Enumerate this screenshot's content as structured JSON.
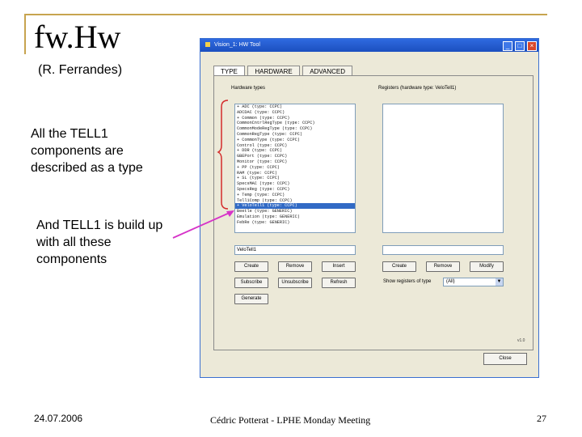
{
  "slide": {
    "title": "fw.Hw",
    "author": "(R. Ferrandes)",
    "text1": "All the TELL1 components are described as a type",
    "text2": "And TELL1 is build up with all these components",
    "footer_date": "24.07.2006",
    "footer_center": "Cédric Potterat - LPHE Monday Meeting",
    "page_number": "27"
  },
  "colors": {
    "frame_accent": "#c7a44f",
    "brace_red": "#d42a2a",
    "arrow_magenta": "#d633c8",
    "selection_blue": "#316ac5"
  },
  "window": {
    "title": "Vision_1: HW Tool",
    "tabs": [
      "TYPE",
      "HARDWARE",
      "ADVANCED"
    ],
    "active_tab": "TYPE",
    "hardware_types_label": "Hardware types",
    "registers_label": "Registers (hardware type: VeloTell1)",
    "hardware_types": [
      "+ ADC (type: CCPC)",
      "ADCDAC (type: CCPC)",
      "+ Common (type: CCPC)",
      "CommonCntrlRegType (type: CCPC)",
      "CommonModeRegType (type: CCPC)",
      "CommonRegType (type: CCPC)",
      "+ CommonType (type: CCPC)",
      "Control (type: CCPC)",
      "+ DDR (type: CCPC)",
      "GBEPort (type: CCPC)",
      "Monitor (type: CCPC)",
      "+ PP (type: CCPC)",
      "RAM (type: CCPC)",
      "+ SL (type: CCPC)",
      "SpecsMAC (type: CCPC)",
      "SpecsReg (type: CCPC)",
      "+ Temp (type: CCPC)",
      "Tell1Comp (type: CCPC)",
      "+ VeloTell1 (type: CCPC)",
      "Beetle (type: GENERIC)",
      "Emulation (type: GENERIC)",
      "FebRe (type: GENERIC)"
    ],
    "selected_index": 18,
    "registers": [],
    "type_name_value": "VeloTell1",
    "register_name_value": "",
    "buttons_left_row1": [
      "Create",
      "Remove",
      "Insert"
    ],
    "buttons_left_row2": [
      "Subscribe",
      "Unsubscribe",
      "Refresh"
    ],
    "button_generate": "Generate",
    "buttons_right_row1": [
      "Create",
      "Remove",
      "Modify"
    ],
    "show_registers_label": "Show registers of type",
    "show_registers_value": "(All)",
    "version": "v1.0",
    "close_label": "Close"
  }
}
